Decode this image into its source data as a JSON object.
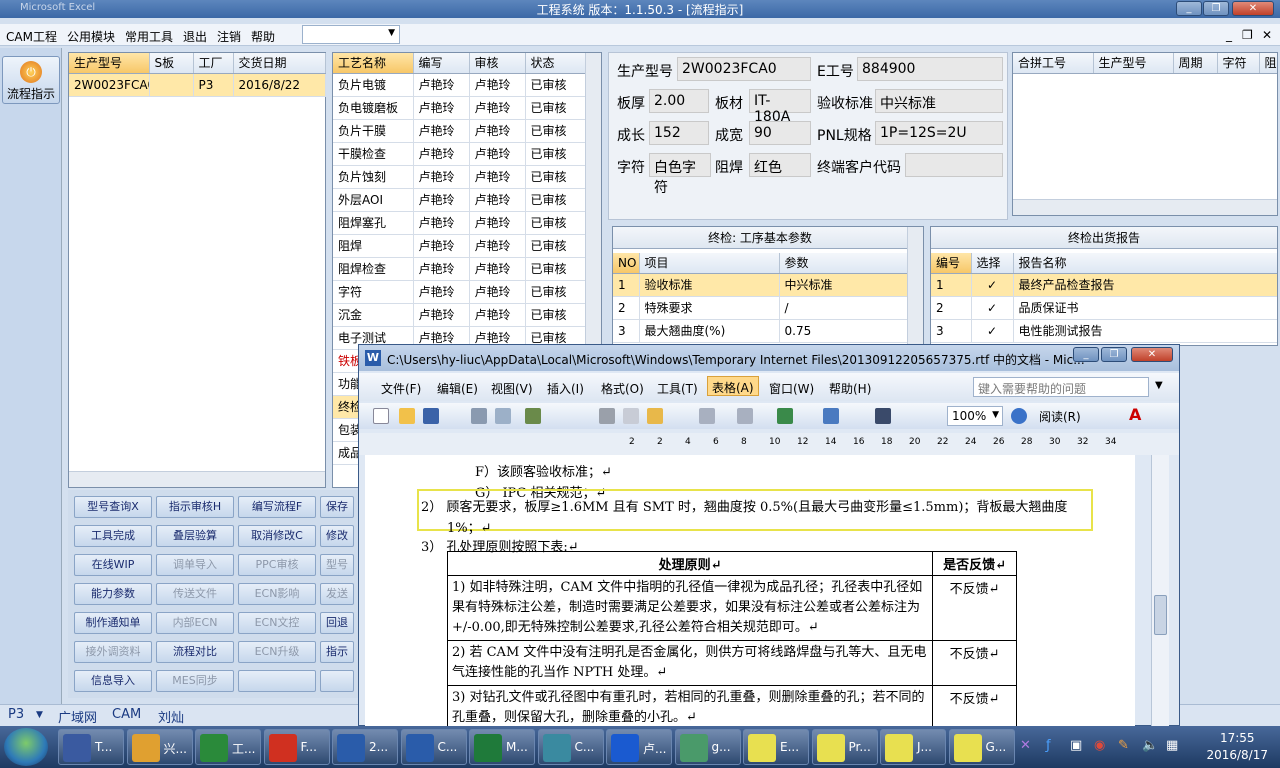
{
  "window": {
    "title": "工程系统  版本：1.1.50.3 - [流程指示]",
    "small_app": "Microsoft Excel"
  },
  "menu": {
    "items": [
      "CAM工程",
      "公用模块",
      "常用工具",
      "退出",
      "注销",
      "帮助"
    ],
    "combo_value": ""
  },
  "leftnav": {
    "flow_button": "流程指示"
  },
  "orders": {
    "headers": [
      "生产型号",
      "S板",
      "工厂",
      "交货日期"
    ],
    "rows": [
      [
        "2W0023FCA0",
        "",
        "P3",
        "2016/8/22"
      ]
    ]
  },
  "process": {
    "headers": [
      "工艺名称",
      "编写",
      "审核",
      "状态"
    ],
    "rows": [
      [
        "负片电镀",
        "卢艳玲",
        "卢艳玲",
        "已审核"
      ],
      [
        "负电镀磨板",
        "卢艳玲",
        "卢艳玲",
        "已审核"
      ],
      [
        "负片干膜",
        "卢艳玲",
        "卢艳玲",
        "已审核"
      ],
      [
        "干膜检查",
        "卢艳玲",
        "卢艳玲",
        "已审核"
      ],
      [
        "负片蚀刻",
        "卢艳玲",
        "卢艳玲",
        "已审核"
      ],
      [
        "外层AOI",
        "卢艳玲",
        "卢艳玲",
        "已审核"
      ],
      [
        "阻焊塞孔",
        "卢艳玲",
        "卢艳玲",
        "已审核"
      ],
      [
        "阻焊",
        "卢艳玲",
        "卢艳玲",
        "已审核"
      ],
      [
        "阻焊检查",
        "卢艳玲",
        "卢艳玲",
        "已审核"
      ],
      [
        "字符",
        "卢艳玲",
        "卢艳玲",
        "已审核"
      ],
      [
        "沉金",
        "卢艳玲",
        "卢艳玲",
        "已审核"
      ],
      [
        "电子测试",
        "卢艳玲",
        "卢艳玲",
        "已审核"
      ],
      [
        "铁板",
        "",
        "",
        ""
      ],
      [
        "功能",
        "",
        "",
        ""
      ],
      [
        "终检",
        "",
        "",
        ""
      ],
      [
        "包装",
        "",
        "",
        ""
      ],
      [
        "成品",
        "",
        "",
        ""
      ]
    ]
  },
  "info": {
    "model_label": "生产型号",
    "model": "2W0023FCA0",
    "eno_label": "E工号",
    "eno": "884900",
    "thick_label": "板厚",
    "thick": "2.00",
    "mat_label": "板材",
    "mat": "IT-180A",
    "std_label": "验收标准",
    "std": "中兴标准",
    "len_label": "成长",
    "len": "152",
    "wid_label": "成宽",
    "wid": "90",
    "pnl_label": "PNL规格",
    "pnl": "1P=12S=2U",
    "char_label": "字符",
    "char": "白色字符",
    "mask_label": "阻焊",
    "mask": "红色",
    "cust_label": "终端客户代码",
    "cust": ""
  },
  "merge": {
    "headers": [
      "合拼工号",
      "生产型号",
      "周期",
      "字符",
      "阻"
    ]
  },
  "final_params": {
    "caption": "终检: 工序基本参数",
    "headers": [
      "NO",
      "项目",
      "参数"
    ],
    "rows": [
      [
        "1",
        "验收标准",
        "中兴标准"
      ],
      [
        "2",
        "特殊要求",
        "/"
      ],
      [
        "3",
        "最大翘曲度(%)",
        "0.75"
      ]
    ]
  },
  "report": {
    "caption": "终检出货报告",
    "headers": [
      "编号",
      "选择",
      "报告名称"
    ],
    "rows": [
      [
        "1",
        "✓",
        "最终产品检查报告"
      ],
      [
        "2",
        "✓",
        "品质保证书"
      ],
      [
        "3",
        "✓",
        "电性能测试报告"
      ]
    ]
  },
  "buttons": [
    [
      "型号查询X",
      "指示审核H",
      "编写流程F",
      "保存"
    ],
    [
      "工具完成",
      "叠层验算",
      "取消修改C",
      "修改"
    ],
    [
      "在线WIP",
      "调单导入",
      "PPC审核",
      "型号"
    ],
    [
      "能力参数",
      "传送文件",
      "ECN影响",
      "发送"
    ],
    [
      "制作通知单",
      "内部ECN",
      "ECN文控",
      "回退"
    ],
    [
      "接外调资料",
      "流程对比",
      "ECN升级",
      "指示"
    ],
    [
      "信息导入",
      "MES同步",
      "",
      ""
    ]
  ],
  "status": {
    "factory": "P3",
    "net": "广域网",
    "dept": "CAM",
    "user": "刘灿"
  },
  "word": {
    "title": "C:\\Users\\hy-liuc\\AppData\\Local\\Microsoft\\Windows\\Temporary Internet Files\\20130912205657375.rtf 中的文档 - Mic...",
    "menu": [
      "文件(F)",
      "编辑(E)",
      "视图(V)",
      "插入(I)",
      "格式(O)",
      "工具(T)",
      "表格(A)",
      "窗口(W)",
      "帮助(H)"
    ],
    "search_placeholder": "键入需要帮助的问题",
    "zoom": "100%",
    "read_label": "阅读(R)",
    "ruler": [
      "2",
      "2",
      "4",
      "6",
      "8",
      "10",
      "12",
      "14",
      "16",
      "18",
      "20",
      "22",
      "24",
      "26",
      "28",
      "30",
      "32",
      "34"
    ],
    "lines": {
      "f": "F）该顾客验收标准；↵",
      "g": "G） IPC 相关规范；↵",
      "p2a": "2） 顾客无要求，板厚≥1.6MM 且有 SMT 时，翘曲度按 0.5%(且最大弓曲变形量≤1.5mm)；背板最大翘曲度",
      "p2b": "1%；↵",
      "p3": "3） 孔处理原则按照下表:↵"
    },
    "table": {
      "headers": [
        "处理原则↵",
        "是否反馈↵"
      ],
      "rows": [
        [
          "1) 如非特殊注明，CAM 文件中指明的孔径值一律视为成品孔径；孔径表中孔径如果有特殊标注公差，制造时需要满足公差要求，如果没有标注公差或者公差标注为+/-0.00,即无特殊控制公差要求,孔径公差符合相关规范即可。↵",
          "不反馈↵"
        ],
        [
          "2) 若 CAM 文件中没有注明孔是否金属化，则供方可将线路焊盘与孔等大、且无电气连接性能的孔当作 NPTH 处理。↵",
          "不反馈↵"
        ],
        [
          "3) 对钻孔文件或孔径图中有重孔时，若相同的孔重叠，则删除重叠的孔；若不同的孔重叠，则保留大孔，删除重叠的小孔。↵",
          "不反馈↵"
        ]
      ]
    }
  },
  "taskbar": {
    "items": [
      "T...",
      "兴...",
      "工...",
      "F...",
      "2...",
      "C...",
      "M...",
      "C...",
      "卢...",
      "g...",
      "E...",
      "Pr...",
      "J...",
      "G..."
    ],
    "time": "17:55",
    "date": "2016/8/17"
  },
  "colors": {
    "accent": "#ffe8a8",
    "highlight_border": "#e8e34a",
    "taskbar": "#2a4a78"
  }
}
